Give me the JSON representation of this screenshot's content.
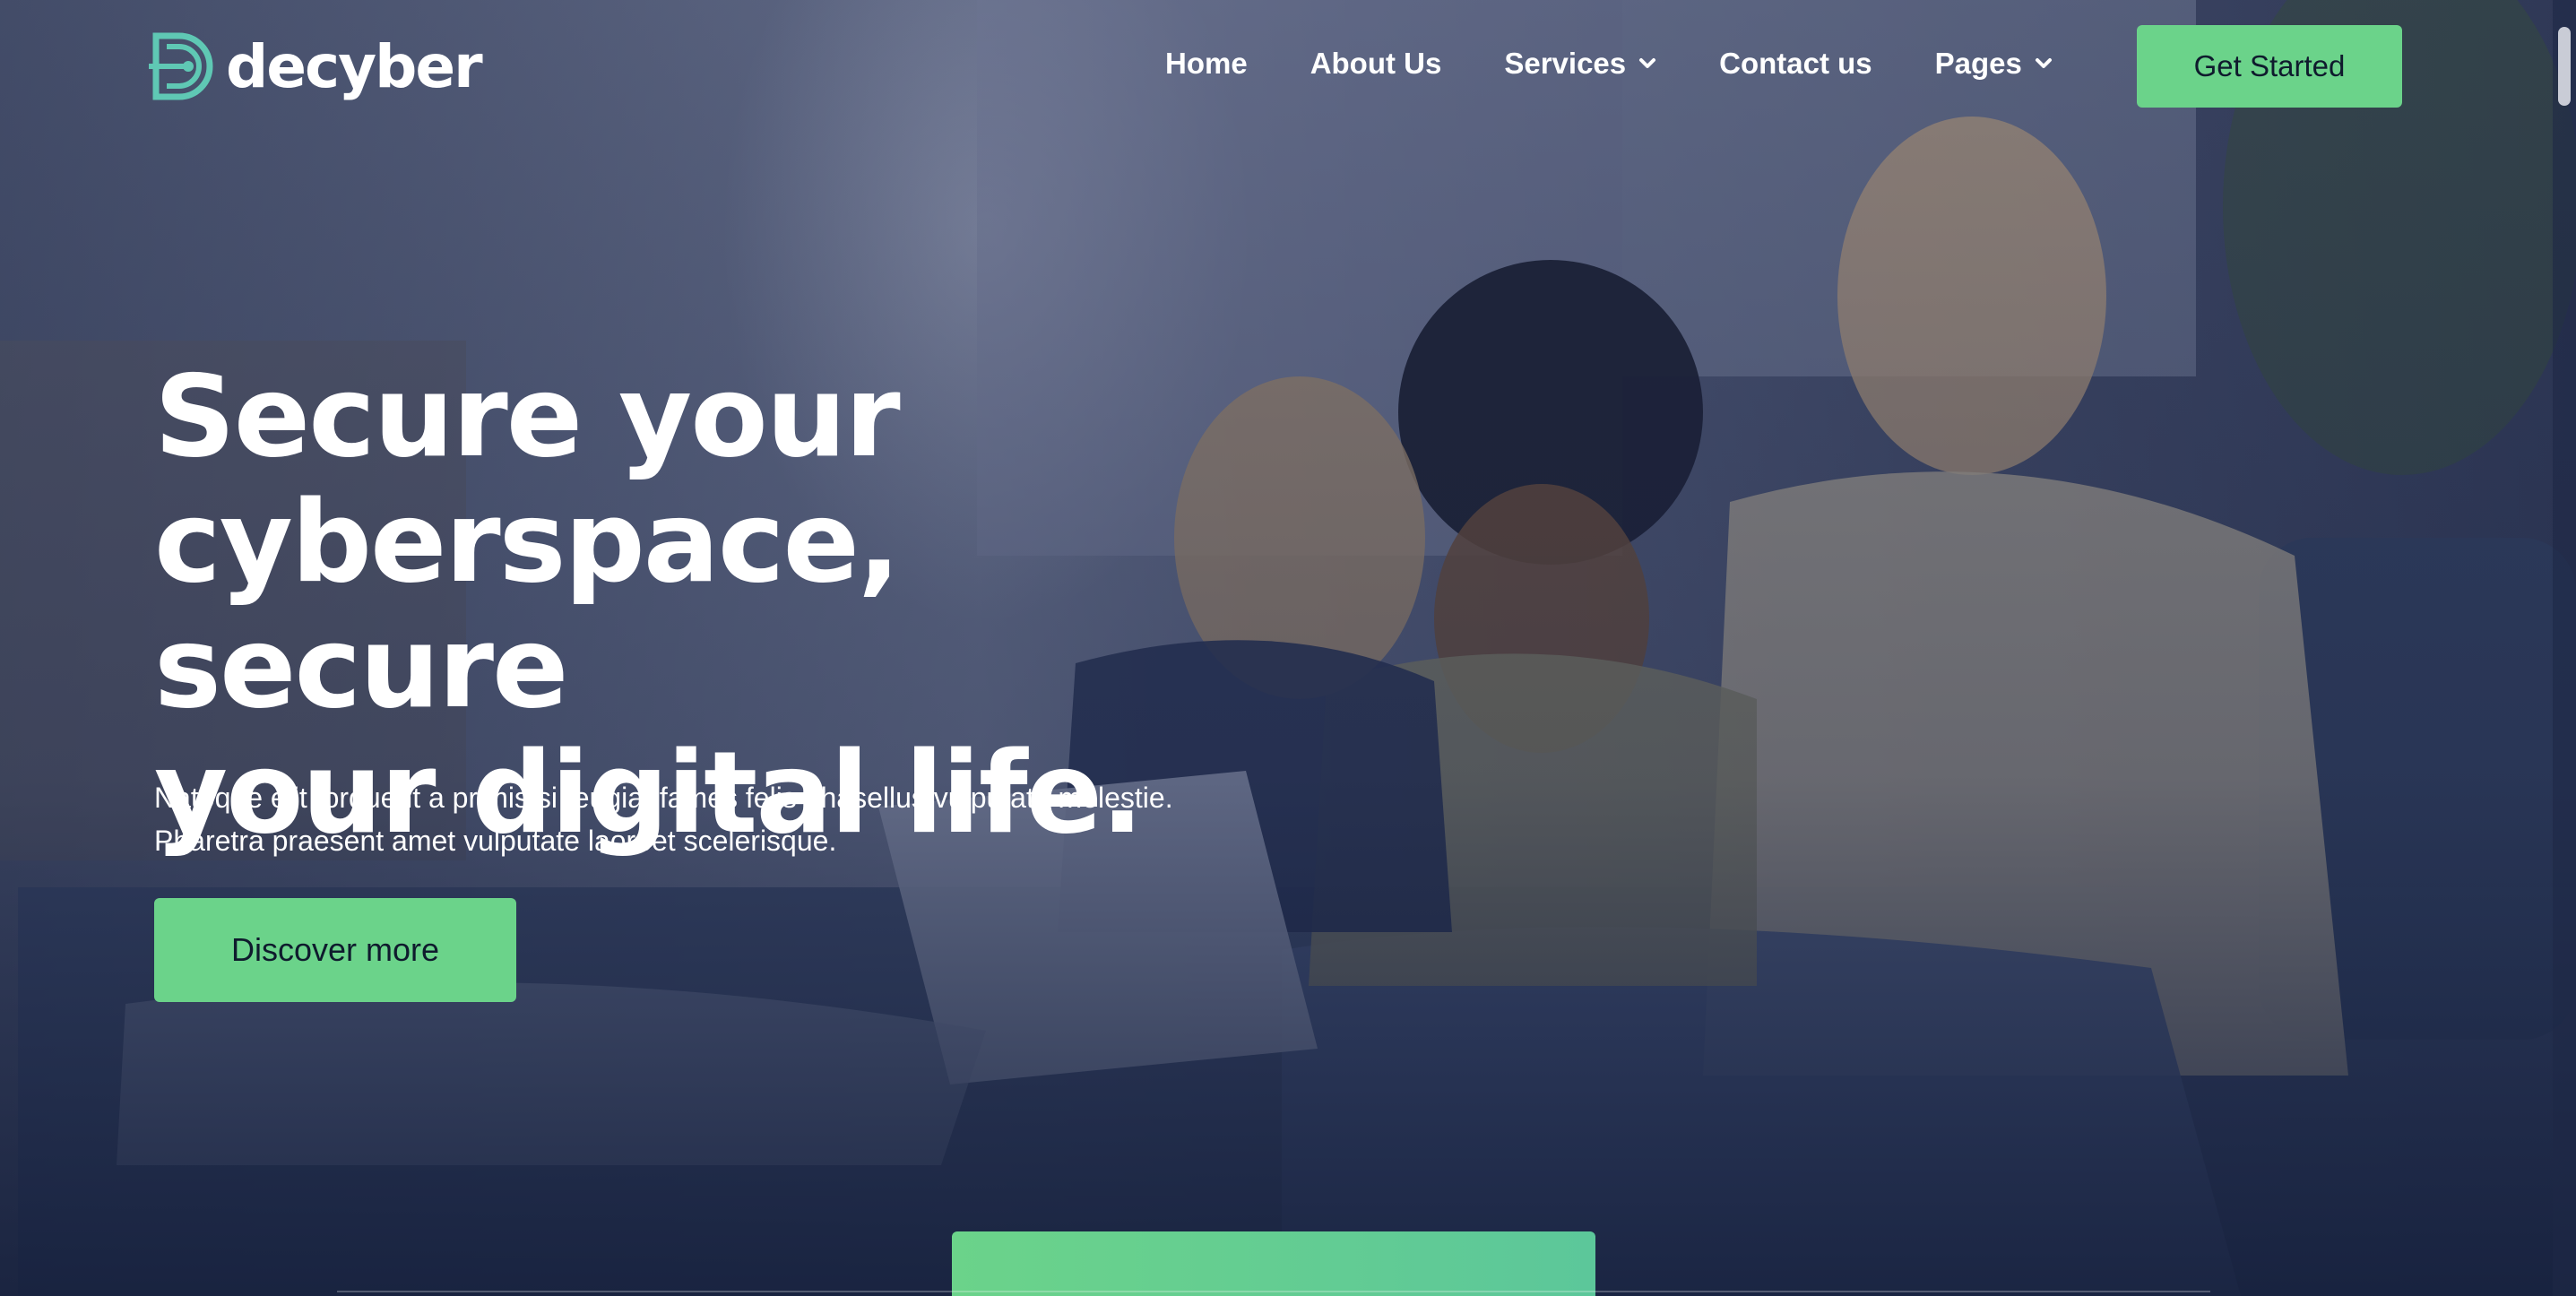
{
  "brand": {
    "name": "decyber",
    "accent": "#6bd38a"
  },
  "nav": {
    "items": [
      {
        "label": "Home",
        "has_dropdown": false
      },
      {
        "label": "About Us",
        "has_dropdown": false
      },
      {
        "label": "Services",
        "has_dropdown": true
      },
      {
        "label": "Contact us",
        "has_dropdown": false
      },
      {
        "label": "Pages",
        "has_dropdown": true
      }
    ],
    "cta_label": "Get Started"
  },
  "hero": {
    "headline_lines": [
      "Secure your",
      "cyberspace, secure",
      "your digital life."
    ],
    "subtext_lines": [
      "Natoque elit torquent a primis si feugiat fames felis phasellus vulputate molestie.",
      "Pharetra praesent amet vulputate laoreet scelerisque."
    ],
    "button_label": "Discover more"
  }
}
